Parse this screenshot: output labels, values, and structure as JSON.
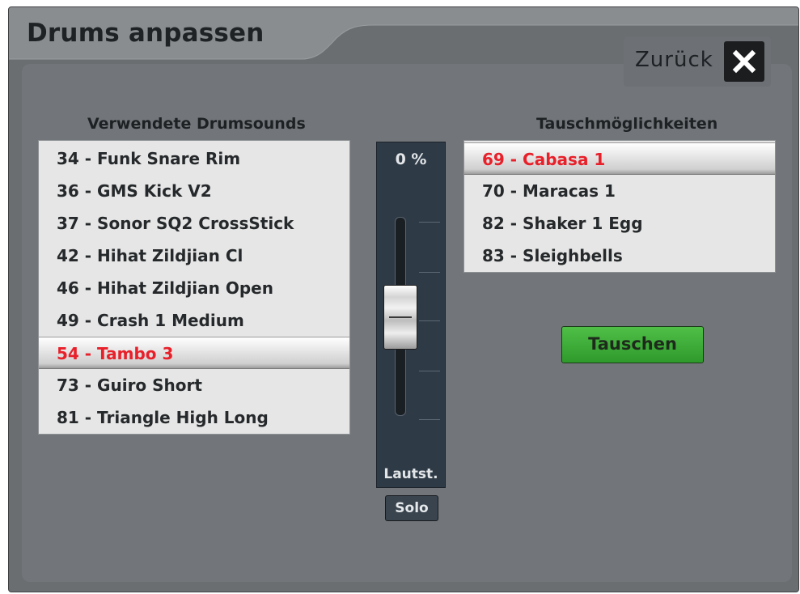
{
  "dialog": {
    "title": "Drums anpassen",
    "back_label": "Zurück"
  },
  "used_sounds": {
    "header": "Verwendete Drumsounds",
    "items": [
      {
        "label": "34 - Funk Snare Rim",
        "selected": false
      },
      {
        "label": "36 - GMS Kick V2",
        "selected": false
      },
      {
        "label": "37 - Sonor SQ2 CrossStick",
        "selected": false
      },
      {
        "label": "42 - Hihat Zildjian Cl",
        "selected": false
      },
      {
        "label": "46 - Hihat Zildjian Open",
        "selected": false
      },
      {
        "label": "49 - Crash 1 Medium",
        "selected": false
      },
      {
        "label": "54 - Tambo 3",
        "selected": true
      },
      {
        "label": "73 - Guiro Short",
        "selected": false
      },
      {
        "label": "81 - Triangle High Long",
        "selected": false
      }
    ]
  },
  "swap_options": {
    "header": "Tauschmöglichkeiten",
    "items": [
      {
        "label": "69 - Cabasa 1",
        "selected": true
      },
      {
        "label": "70 - Maracas 1",
        "selected": false
      },
      {
        "label": "82 - Shaker 1 Egg",
        "selected": false
      },
      {
        "label": "83 - Sleighbells",
        "selected": false
      }
    ]
  },
  "fader": {
    "value_text": "0 %",
    "label": "Lautst.",
    "solo_label": "Solo"
  },
  "actions": {
    "swap_label": "Tauschen"
  },
  "colors": {
    "selected_text": "#e8202a",
    "swap_button": "#3aa935",
    "fader_panel": "#2e3a46"
  }
}
